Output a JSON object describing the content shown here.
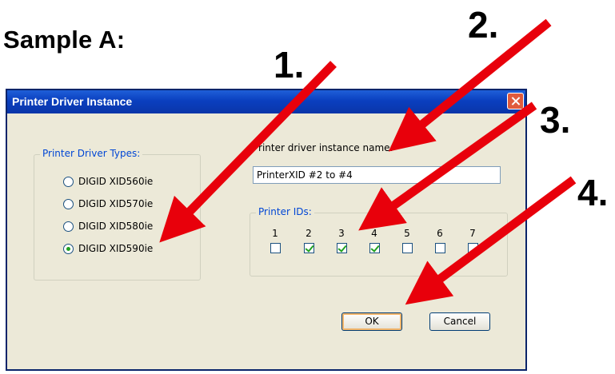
{
  "heading": "Sample A:",
  "steps": [
    "1.",
    "2.",
    "3.",
    "4."
  ],
  "dialog": {
    "title": "Printer Driver Instance",
    "driver_types_label": "Printer Driver Types:",
    "driver_options": [
      {
        "label": "DIGID XID560ie",
        "selected": false
      },
      {
        "label": "DIGID XID570ie",
        "selected": false
      },
      {
        "label": "DIGID XID580ie",
        "selected": false
      },
      {
        "label": "DIGID XID590ie",
        "selected": true
      }
    ],
    "instance_name_label": "Printer driver instance name:",
    "instance_name_value": "PrinterXID #2 to #4",
    "printer_ids_label": "Printer IDs:",
    "printer_ids": [
      {
        "label": "1",
        "checked": false
      },
      {
        "label": "2",
        "checked": true
      },
      {
        "label": "3",
        "checked": true
      },
      {
        "label": "4",
        "checked": true
      },
      {
        "label": "5",
        "checked": false
      },
      {
        "label": "6",
        "checked": false
      },
      {
        "label": "7",
        "checked": false
      }
    ],
    "ok_label": "OK",
    "cancel_label": "Cancel"
  },
  "colors": {
    "arrow": "#e8000b",
    "title_bar": "#0a3fbf",
    "dialog_bg": "#ece9d8",
    "accent": "#0046d5"
  }
}
